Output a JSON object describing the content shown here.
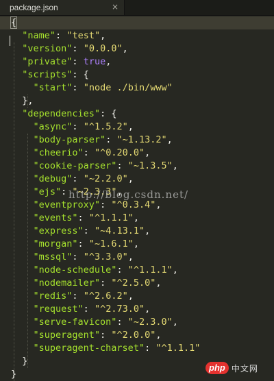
{
  "tab": {
    "title": "package.json",
    "close_glyph": "×",
    "close_icon": "close-icon"
  },
  "editor": {
    "lines": [
      [
        [
          "p",
          "{"
        ]
      ],
      [
        [
          "p",
          "  "
        ],
        [
          "k",
          "\"name\""
        ],
        [
          "p",
          ": "
        ],
        [
          "s",
          "\"test\""
        ],
        [
          "p",
          ","
        ]
      ],
      [
        [
          "p",
          "  "
        ],
        [
          "k",
          "\"version\""
        ],
        [
          "p",
          ": "
        ],
        [
          "s",
          "\"0.0.0\""
        ],
        [
          "p",
          ","
        ]
      ],
      [
        [
          "p",
          "  "
        ],
        [
          "k",
          "\"private\""
        ],
        [
          "p",
          ": "
        ],
        [
          "c",
          "true"
        ],
        [
          "p",
          ","
        ]
      ],
      [
        [
          "p",
          "  "
        ],
        [
          "k",
          "\"scripts\""
        ],
        [
          "p",
          ": {"
        ]
      ],
      [
        [
          "p",
          "    "
        ],
        [
          "k",
          "\"start\""
        ],
        [
          "p",
          ": "
        ],
        [
          "s",
          "\"node ./bin/www\""
        ]
      ],
      [
        [
          "p",
          "  },"
        ]
      ],
      [
        [
          "p",
          "  "
        ],
        [
          "k",
          "\"dependencies\""
        ],
        [
          "p",
          ": {"
        ]
      ],
      [
        [
          "p",
          "    "
        ],
        [
          "k",
          "\"async\""
        ],
        [
          "p",
          ": "
        ],
        [
          "s",
          "\"^1.5.2\""
        ],
        [
          "p",
          ","
        ]
      ],
      [
        [
          "p",
          "    "
        ],
        [
          "k",
          "\"body-parser\""
        ],
        [
          "p",
          ": "
        ],
        [
          "s",
          "\"~1.13.2\""
        ],
        [
          "p",
          ","
        ]
      ],
      [
        [
          "p",
          "    "
        ],
        [
          "k",
          "\"cheerio\""
        ],
        [
          "p",
          ": "
        ],
        [
          "s",
          "\"^0.20.0\""
        ],
        [
          "p",
          ","
        ]
      ],
      [
        [
          "p",
          "    "
        ],
        [
          "k",
          "\"cookie-parser\""
        ],
        [
          "p",
          ": "
        ],
        [
          "s",
          "\"~1.3.5\""
        ],
        [
          "p",
          ","
        ]
      ],
      [
        [
          "p",
          "    "
        ],
        [
          "k",
          "\"debug\""
        ],
        [
          "p",
          ": "
        ],
        [
          "s",
          "\"~2.2.0\""
        ],
        [
          "p",
          ","
        ]
      ],
      [
        [
          "p",
          "    "
        ],
        [
          "k",
          "\"ejs\""
        ],
        [
          "p",
          ": "
        ],
        [
          "s",
          "\"~2.3.3\""
        ],
        [
          "p",
          ","
        ]
      ],
      [
        [
          "p",
          "    "
        ],
        [
          "k",
          "\"eventproxy\""
        ],
        [
          "p",
          ": "
        ],
        [
          "s",
          "\"^0.3.4\""
        ],
        [
          "p",
          ","
        ]
      ],
      [
        [
          "p",
          "    "
        ],
        [
          "k",
          "\"events\""
        ],
        [
          "p",
          ": "
        ],
        [
          "s",
          "\"^1.1.1\""
        ],
        [
          "p",
          ","
        ]
      ],
      [
        [
          "p",
          "    "
        ],
        [
          "k",
          "\"express\""
        ],
        [
          "p",
          ": "
        ],
        [
          "s",
          "\"~4.13.1\""
        ],
        [
          "p",
          ","
        ]
      ],
      [
        [
          "p",
          "    "
        ],
        [
          "k",
          "\"morgan\""
        ],
        [
          "p",
          ": "
        ],
        [
          "s",
          "\"~1.6.1\""
        ],
        [
          "p",
          ","
        ]
      ],
      [
        [
          "p",
          "    "
        ],
        [
          "k",
          "\"mssql\""
        ],
        [
          "p",
          ": "
        ],
        [
          "s",
          "\"^3.3.0\""
        ],
        [
          "p",
          ","
        ]
      ],
      [
        [
          "p",
          "    "
        ],
        [
          "k",
          "\"node-schedule\""
        ],
        [
          "p",
          ": "
        ],
        [
          "s",
          "\"^1.1.1\""
        ],
        [
          "p",
          ","
        ]
      ],
      [
        [
          "p",
          "    "
        ],
        [
          "k",
          "\"nodemailer\""
        ],
        [
          "p",
          ": "
        ],
        [
          "s",
          "\"^2.5.0\""
        ],
        [
          "p",
          ","
        ]
      ],
      [
        [
          "p",
          "    "
        ],
        [
          "k",
          "\"redis\""
        ],
        [
          "p",
          ": "
        ],
        [
          "s",
          "\"^2.6.2\""
        ],
        [
          "p",
          ","
        ]
      ],
      [
        [
          "p",
          "    "
        ],
        [
          "k",
          "\"request\""
        ],
        [
          "p",
          ": "
        ],
        [
          "s",
          "\"^2.73.0\""
        ],
        [
          "p",
          ","
        ]
      ],
      [
        [
          "p",
          "    "
        ],
        [
          "k",
          "\"serve-favicon\""
        ],
        [
          "p",
          ": "
        ],
        [
          "s",
          "\"~2.3.0\""
        ],
        [
          "p",
          ","
        ]
      ],
      [
        [
          "p",
          "    "
        ],
        [
          "k",
          "\"superagent\""
        ],
        [
          "p",
          ": "
        ],
        [
          "s",
          "\"^2.0.0\""
        ],
        [
          "p",
          ","
        ]
      ],
      [
        [
          "p",
          "    "
        ],
        [
          "k",
          "\"superagent-charset\""
        ],
        [
          "p",
          ": "
        ],
        [
          "s",
          "\"^1.1.1\""
        ]
      ],
      [
        [
          "p",
          "  }"
        ]
      ],
      [
        [
          "p",
          "}"
        ]
      ]
    ]
  },
  "watermark": {
    "url": "http://blog.csdn.net/",
    "logo_mark": "php",
    "logo_text": "中文网"
  },
  "colors": {
    "background": "#272822",
    "key": "#a6e22e",
    "string": "#e6db74",
    "constant": "#ae81ff",
    "punctuation": "#f8f8f2"
  }
}
